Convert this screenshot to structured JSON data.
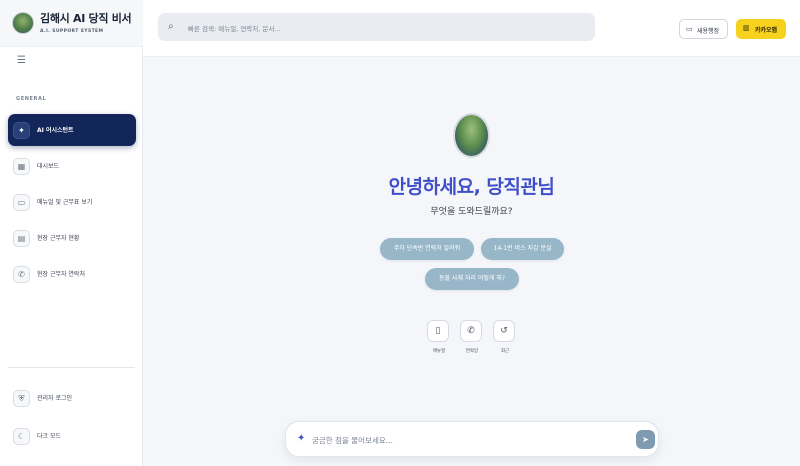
{
  "app": {
    "title": "김해시 AI 당직 비서",
    "subtitle": "A.I. SUPPORT SYSTEM"
  },
  "sidebar": {
    "menu_icon": "menu-icon",
    "section_label": "GENERAL",
    "items": [
      {
        "label": "AI 어시스턴트",
        "icon": "sparkle-icon",
        "active": true
      },
      {
        "label": "대시보드",
        "icon": "dashboard-icon",
        "active": false
      },
      {
        "label": "매뉴얼 및 근무표 보기",
        "icon": "book-icon",
        "active": false
      },
      {
        "label": "현장 근무자 현황",
        "icon": "clipboard-icon",
        "active": false
      },
      {
        "label": "현장 근무자 연락처",
        "icon": "phone-icon",
        "active": false
      }
    ],
    "bottom_items": [
      {
        "label": "관리자 로그인",
        "icon": "shield-icon"
      },
      {
        "label": "다크 모드",
        "icon": "moon-icon"
      }
    ]
  },
  "topbar": {
    "search_placeholder": "빠른 검색: 매뉴얼, 연락처, 문서...",
    "new_button": "새용행정",
    "kakao_button": "카카오맵"
  },
  "main": {
    "greeting": "안녕하세요, 당직관님",
    "subtitle": "무엇을 도와드릴까요?",
    "suggestions": [
      "주차 단속반 연락처 알려줘",
      "14-1번 버스 지갑 분실",
      "동물 사체 처리 어떻게 해?"
    ],
    "quick_actions": [
      {
        "label": "매뉴얼",
        "icon": "book-icon"
      },
      {
        "label": "연락망",
        "icon": "phone-icon"
      },
      {
        "label": "최근",
        "icon": "history-icon"
      }
    ],
    "composer_placeholder": "궁금한 점을 물어보세요..."
  },
  "colors": {
    "accent": "#3f4fc9",
    "active_nav": "#13265a",
    "chip": "#97b6c8",
    "kakao": "#f7d21c"
  }
}
